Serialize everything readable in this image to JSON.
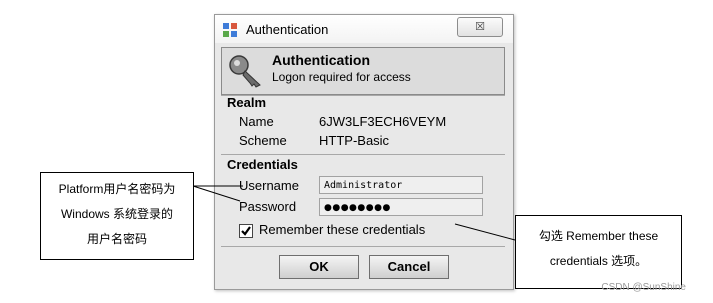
{
  "window": {
    "title": "Authentication",
    "close_glyph": "☒",
    "title_icon": "app-grid-icon"
  },
  "header": {
    "icon": "key-icon",
    "title": "Authentication",
    "subtitle": "Logon required for access"
  },
  "realm": {
    "section_title": "Realm",
    "name_label": "Name",
    "name_value": "6JW3LF3ECH6VEYM",
    "scheme_label": "Scheme",
    "scheme_value": "HTTP-Basic"
  },
  "credentials": {
    "section_title": "Credentials",
    "username_label": "Username",
    "username_value": "Administrator",
    "password_label": "Password",
    "password_value": "●●●●●●●●",
    "remember_label": "Remember these credentials",
    "remember_checked": true
  },
  "buttons": {
    "ok_label": "OK",
    "cancel_label": "Cancel"
  },
  "annotations": {
    "left_line1": "Platform用户名密码为",
    "left_line2": "Windows 系统登录的",
    "left_line3": "用户名密码",
    "right_line1": "勾选 Remember these",
    "right_line2": "credentials 选项。"
  },
  "watermark": "CSDN @SunShine"
}
